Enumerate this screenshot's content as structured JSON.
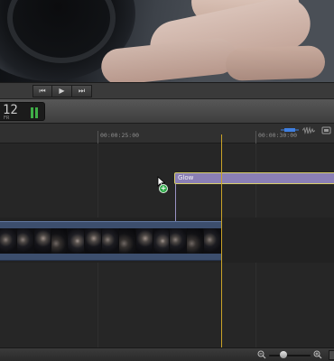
{
  "viewer": {
    "description_icon": "video-frame-icon"
  },
  "transport": {
    "prev_icon": "skip-back-icon",
    "play_icon": "play-icon",
    "next_icon": "skip-forward-icon",
    "prev_glyph": "⏮",
    "play_glyph": "▶",
    "next_glyph": "⏭"
  },
  "toolbar": {
    "timecode_value": "12",
    "timecode_unit": "FR",
    "meter_color": "#3fae47"
  },
  "ruler": {
    "marks": [
      "00:00:25:00",
      "00:00:30:00"
    ],
    "icons": [
      "blue-clip-icon",
      "audio-waveform-icon",
      "skimming-icon"
    ]
  },
  "timeline": {
    "title_clip": {
      "label": "Glow",
      "color": "#8a7fb5"
    },
    "video_clip": {
      "color": "#3c4e6d",
      "frame_count": 13
    },
    "add_badge": "+",
    "playhead_color": "#c9a227"
  },
  "bottombar": {
    "zoom_out_icon": "zoom-out-icon",
    "zoom_in_icon": "zoom-in-icon",
    "zoom_level_fraction": 0.35
  }
}
